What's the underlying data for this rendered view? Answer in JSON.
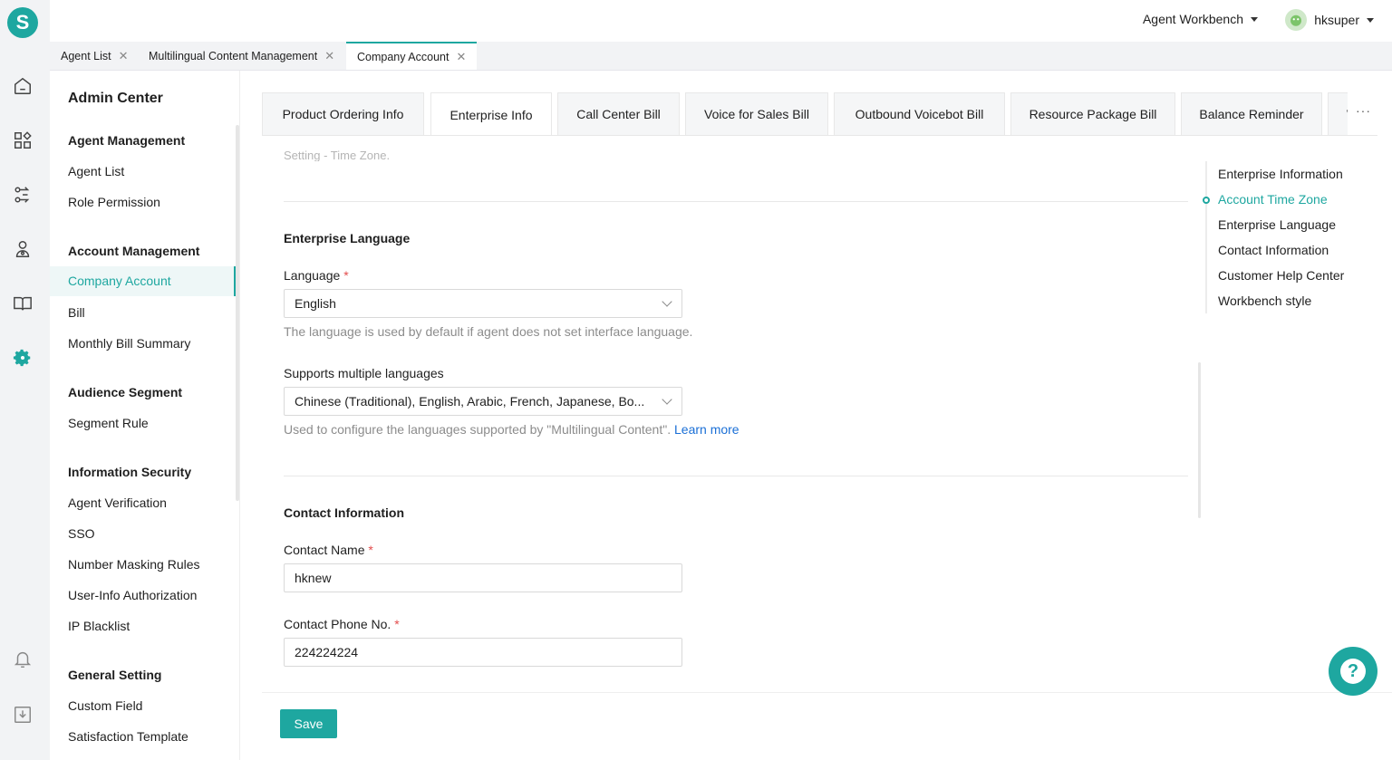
{
  "app": {
    "logo_letter": "S"
  },
  "topbar": {
    "workbench_label": "Agent Workbench",
    "username": "hksuper"
  },
  "page_tabs": [
    {
      "label": "Agent List",
      "close": "✕"
    },
    {
      "label": "Multilingual Content Management",
      "close": "✕"
    },
    {
      "label": "Company Account",
      "close": "✕"
    }
  ],
  "sidebar": {
    "title": "Admin Center",
    "groups": [
      {
        "title": "Agent Management",
        "items": [
          "Agent List",
          "Role Permission"
        ]
      },
      {
        "title": "Account Management",
        "items": [
          "Company Account",
          "Bill",
          "Monthly Bill Summary"
        ]
      },
      {
        "title": "Audience Segment",
        "items": [
          "Segment Rule"
        ]
      },
      {
        "title": "Information Security",
        "items": [
          "Agent Verification",
          "SSO",
          "Number Masking Rules",
          "User-Info Authorization",
          "IP Blacklist"
        ]
      },
      {
        "title": "General Setting",
        "items": [
          "Custom Field",
          "Satisfaction Template"
        ]
      }
    ]
  },
  "subtabs": [
    "Product Ordering Info",
    "Enterprise Info",
    "Call Center Bill",
    "Voice for Sales Bill",
    "Outbound Voicebot Bill",
    "Resource Package Bill",
    "Balance Reminder",
    "W"
  ],
  "more_label": "···",
  "content": {
    "faded_text": "Setting - Time Zone.",
    "enterprise_language": {
      "title": "Enterprise Language",
      "language_label": "Language",
      "language_value": "English",
      "language_hint": "The language is used by default if agent does not set interface language.",
      "multi_label": "Supports multiple languages",
      "multi_value": "Chinese (Traditional), English, Arabic, French, Japanese, Bo...",
      "multi_hint": "Used to configure the languages supported by \"Multilingual Content\".",
      "learn_more": "Learn more"
    },
    "contact_information": {
      "title": "Contact Information",
      "name_label": "Contact Name",
      "name_value": "hknew",
      "phone_label": "Contact Phone No.",
      "phone_value": "224224224"
    },
    "required_mark": "*"
  },
  "anchor_nav": [
    "Enterprise Information",
    "Account Time Zone",
    "Enterprise Language",
    "Contact Information",
    "Customer Help Center",
    "Workbench style"
  ],
  "footer": {
    "save_label": "Save"
  },
  "help": {
    "symbol": "?"
  },
  "colors": {
    "accent": "#1ea7a0",
    "link": "#1a6fd6",
    "required": "#e34d4d"
  }
}
